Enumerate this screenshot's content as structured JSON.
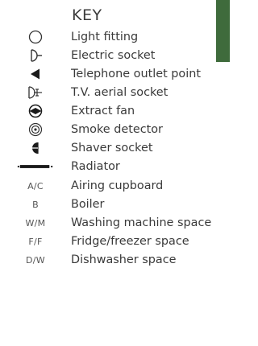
{
  "title": "KEY",
  "accent_color": "#3f6b3c",
  "items": [
    {
      "icon": "light-fitting-icon",
      "label": "Light fitting"
    },
    {
      "icon": "electric-socket-icon",
      "label": "Electric socket"
    },
    {
      "icon": "telephone-outlet-icon",
      "label": "Telephone outlet point"
    },
    {
      "icon": "tv-aerial-socket-icon",
      "label": "T.V. aerial socket"
    },
    {
      "icon": "extract-fan-icon",
      "label": "Extract fan"
    },
    {
      "icon": "smoke-detector-icon",
      "label": "Smoke detector"
    },
    {
      "icon": "shaver-socket-icon",
      "label": "Shaver socket"
    },
    {
      "icon": "radiator-icon",
      "label": "Radiator"
    },
    {
      "abbr": "A/C",
      "label": "Airing cupboard"
    },
    {
      "abbr": "B",
      "label": "Boiler"
    },
    {
      "abbr": "W/M",
      "label": "Washing machine space"
    },
    {
      "abbr": "F/F",
      "label": "Fridge/freezer space"
    },
    {
      "abbr": "D/W",
      "label": "Dishwasher space"
    }
  ]
}
